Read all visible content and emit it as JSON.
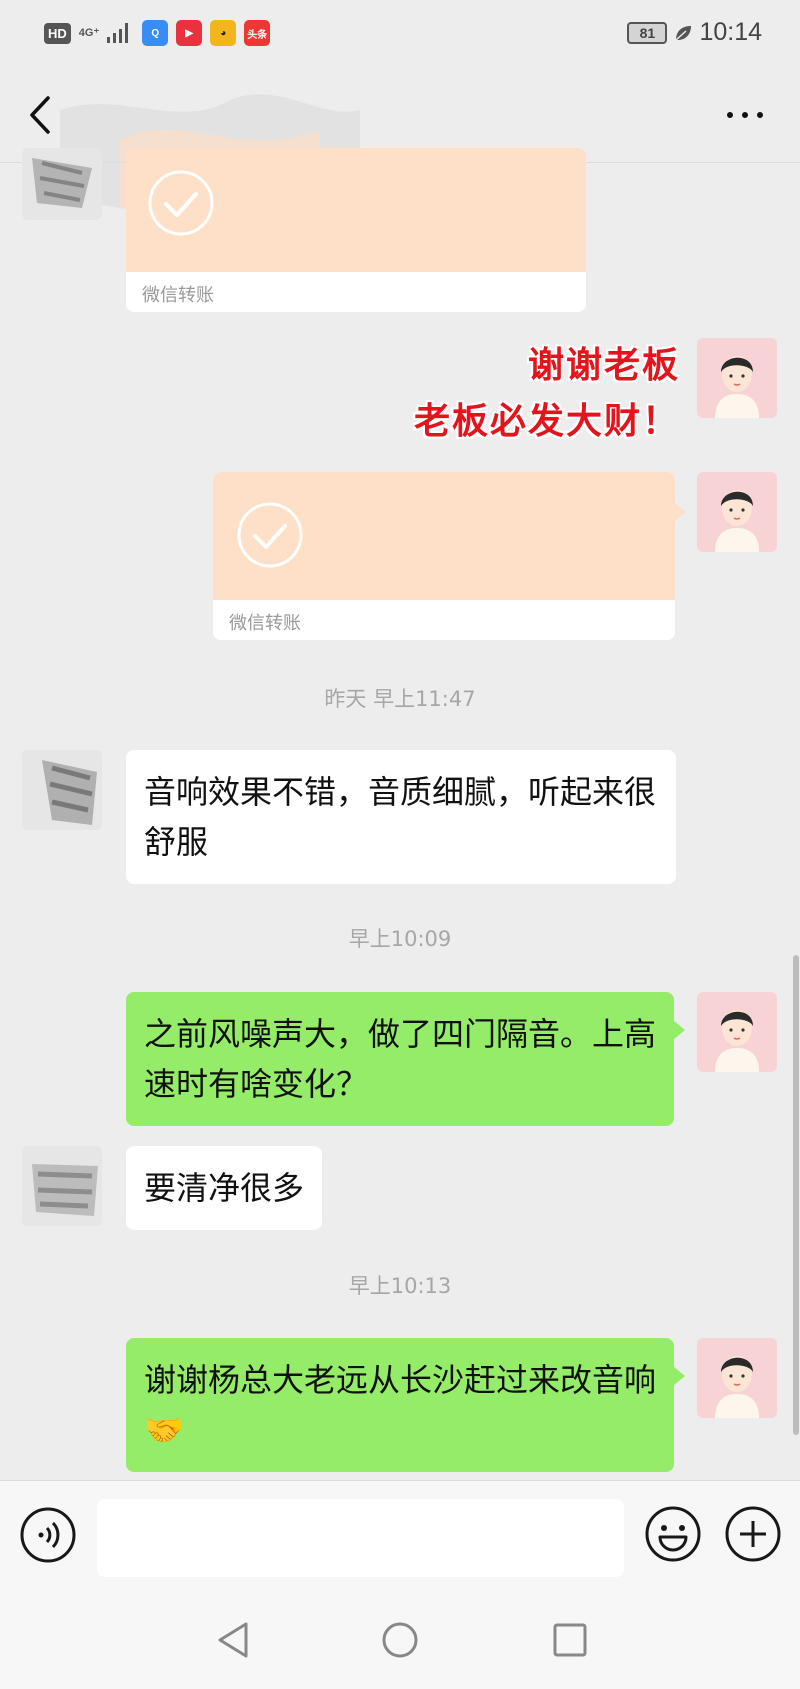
{
  "status_bar": {
    "hd": "HD",
    "network": "4G⁺",
    "apps": [
      {
        "name": "QQ browser",
        "color": "#3a8cf5",
        "glyph": "Q"
      },
      {
        "name": "video app",
        "color": "#e8333f",
        "glyph": "▶"
      },
      {
        "name": "emoji app",
        "color": "#f3b51d",
        "glyph": "◕"
      },
      {
        "name": "toutiao",
        "label": "头条",
        "color": "#ee3733"
      }
    ],
    "battery": "81",
    "time": "10:14"
  },
  "chat": {
    "transfers": [
      {
        "footer": "微信转账"
      },
      {
        "footer": "微信转账"
      }
    ],
    "sticker_lines": [
      "谢谢老板",
      "老板必发大财！"
    ],
    "timestamps": [
      "昨天 早上11:47",
      "早上10:09",
      "早上10:13"
    ],
    "messages": [
      {
        "text": "音响效果不错，音质细腻，听起来很舒服"
      },
      {
        "text": "之前风噪声大，做了四门隔音。上高速时有啥变化？"
      },
      {
        "text": "要清净很多"
      },
      {
        "text": "谢谢杨总大老远从长沙赶过来改音响",
        "emoji": "🤝"
      }
    ]
  },
  "colors": {
    "green_bubble": "#95ec69",
    "transfer_orange": "#fde0c7",
    "sticker_red": "#e3141b"
  }
}
